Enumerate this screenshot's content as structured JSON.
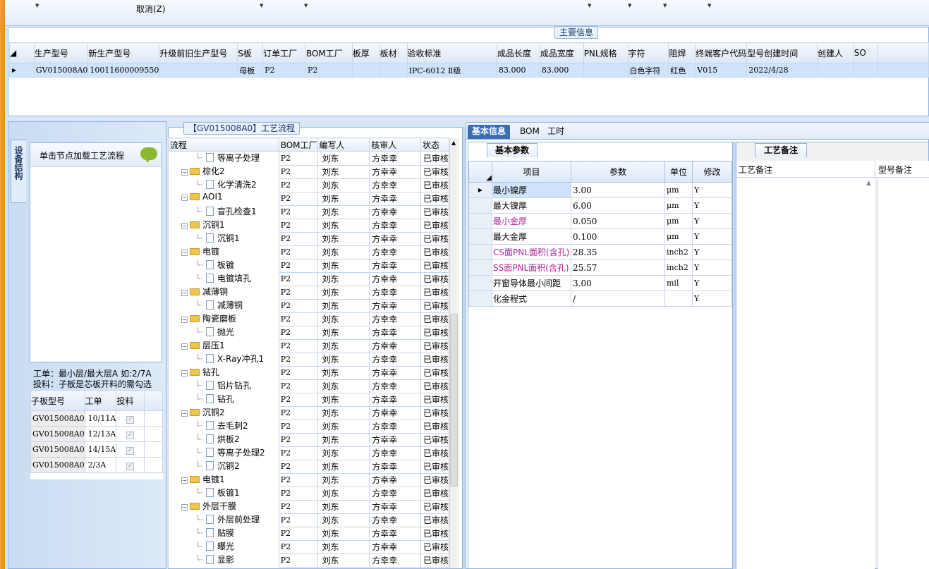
{
  "ribbon": {
    "cancel_label": "取消(Z)"
  },
  "main_info": {
    "title": "主要信息",
    "columns": [
      "生产型号",
      "新生产型号",
      "升级前旧生产型号",
      "S板",
      "订单工厂",
      "BOM工厂",
      "板厚",
      "板材",
      "验收标准",
      "成品长度",
      "成品宽度",
      "PNL规格",
      "字符",
      "阻焊",
      "终端客户代码",
      "型号创建时间",
      "创建人",
      "SO"
    ],
    "row": [
      "GV015008A0",
      "10011600009550",
      "",
      "母板",
      "P2",
      "P2",
      "",
      "",
      "IPC-6012 Ⅱ级",
      "83.000",
      "83.000",
      "",
      "白色字符",
      "红色",
      "V015",
      "2022/4/28",
      "",
      ""
    ]
  },
  "left_panel": {
    "side_tab": "设备结构",
    "load_hint": "单击节点加载工艺流程",
    "note1": "工单：最小层/最大层A 如:2/7A",
    "note2": "投料：子板是芯板开料的需勾选",
    "sub_columns": [
      "子板型号",
      "工单",
      "投料"
    ],
    "sub_rows": [
      {
        "model": "GV015008A0",
        "wo": "10/11A"
      },
      {
        "model": "GV015008A0",
        "wo": "12/13A"
      },
      {
        "model": "GV015008A0",
        "wo": "14/15A"
      },
      {
        "model": "GV015008A0",
        "wo": "2/3A"
      }
    ]
  },
  "process": {
    "title": "【GV015008A0】工艺流程",
    "columns": [
      "流程",
      "BOM工厂",
      "编写人",
      "核审人",
      "状态"
    ],
    "rows": [
      {
        "name": "等离子处理",
        "level": 2,
        "bom": "P2",
        "writer": "刘东",
        "reviewer": "方幸幸",
        "status": "已审核"
      },
      {
        "name": "棕化2",
        "level": 1,
        "bom": "P2",
        "writer": "刘东",
        "reviewer": "方幸幸",
        "status": "已审核"
      },
      {
        "name": "化学清洗2",
        "level": 2,
        "bom": "P2",
        "writer": "刘东",
        "reviewer": "方幸幸",
        "status": "已审核"
      },
      {
        "name": "AOI1",
        "level": 1,
        "bom": "P2",
        "writer": "刘东",
        "reviewer": "方幸幸",
        "status": "已审核"
      },
      {
        "name": "盲孔检查1",
        "level": 2,
        "bom": "P2",
        "writer": "刘东",
        "reviewer": "方幸幸",
        "status": "已审核"
      },
      {
        "name": "沉铜1",
        "level": 1,
        "bom": "P2",
        "writer": "刘东",
        "reviewer": "方幸幸",
        "status": "已审核"
      },
      {
        "name": "沉铜1",
        "level": 2,
        "bom": "P2",
        "writer": "刘东",
        "reviewer": "方幸幸",
        "status": "已审核"
      },
      {
        "name": "电镀",
        "level": 1,
        "bom": "P2",
        "writer": "刘东",
        "reviewer": "方幸幸",
        "status": "已审核"
      },
      {
        "name": "板镀",
        "level": 2,
        "bom": "P2",
        "writer": "刘东",
        "reviewer": "方幸幸",
        "status": "已审核"
      },
      {
        "name": "电镀填孔",
        "level": 2,
        "bom": "P2",
        "writer": "刘东",
        "reviewer": "方幸幸",
        "status": "已审核"
      },
      {
        "name": "减薄铜",
        "level": 1,
        "bom": "P2",
        "writer": "刘东",
        "reviewer": "方幸幸",
        "status": "已审核"
      },
      {
        "name": "减薄铜",
        "level": 2,
        "bom": "P2",
        "writer": "刘东",
        "reviewer": "方幸幸",
        "status": "已审核"
      },
      {
        "name": "陶瓷磨板",
        "level": 1,
        "bom": "P2",
        "writer": "刘东",
        "reviewer": "方幸幸",
        "status": "已审核"
      },
      {
        "name": "抛光",
        "level": 2,
        "bom": "P2",
        "writer": "刘东",
        "reviewer": "方幸幸",
        "status": "已审核"
      },
      {
        "name": "层压1",
        "level": 1,
        "bom": "P2",
        "writer": "刘东",
        "reviewer": "方幸幸",
        "status": "已审核"
      },
      {
        "name": "X-Ray冲孔1",
        "level": 2,
        "bom": "P2",
        "writer": "刘东",
        "reviewer": "方幸幸",
        "status": "已审核"
      },
      {
        "name": "钻孔",
        "level": 1,
        "bom": "P2",
        "writer": "刘东",
        "reviewer": "方幸幸",
        "status": "已审核"
      },
      {
        "name": "铝片钻孔",
        "level": 2,
        "bom": "P2",
        "writer": "刘东",
        "reviewer": "方幸幸",
        "status": "已审核"
      },
      {
        "name": "钻孔",
        "level": 2,
        "bom": "P2",
        "writer": "刘东",
        "reviewer": "方幸幸",
        "status": "已审核"
      },
      {
        "name": "沉铜2",
        "level": 1,
        "bom": "P2",
        "writer": "刘东",
        "reviewer": "方幸幸",
        "status": "已审核"
      },
      {
        "name": "去毛刺2",
        "level": 2,
        "bom": "P2",
        "writer": "刘东",
        "reviewer": "方幸幸",
        "status": "已审核"
      },
      {
        "name": "烘板2",
        "level": 2,
        "bom": "P2",
        "writer": "刘东",
        "reviewer": "方幸幸",
        "status": "已审核"
      },
      {
        "name": "等离子处理2",
        "level": 2,
        "bom": "P2",
        "writer": "刘东",
        "reviewer": "方幸幸",
        "status": "已审核"
      },
      {
        "name": "沉铜2",
        "level": 2,
        "bom": "P2",
        "writer": "刘东",
        "reviewer": "方幸幸",
        "status": "已审核"
      },
      {
        "name": "电镀1",
        "level": 1,
        "bom": "P2",
        "writer": "刘东",
        "reviewer": "方幸幸",
        "status": "已审核"
      },
      {
        "name": "板镀1",
        "level": 2,
        "bom": "P2",
        "writer": "刘东",
        "reviewer": "方幸幸",
        "status": "已审核"
      },
      {
        "name": "外层干膜",
        "level": 1,
        "bom": "P2",
        "writer": "刘东",
        "reviewer": "方幸幸",
        "status": "已审核"
      },
      {
        "name": "外层前处理",
        "level": 2,
        "bom": "P2",
        "writer": "刘东",
        "reviewer": "方幸幸",
        "status": "已审核"
      },
      {
        "name": "贴膜",
        "level": 2,
        "bom": "P2",
        "writer": "刘东",
        "reviewer": "方幸幸",
        "status": "已审核"
      },
      {
        "name": "曝光",
        "level": 2,
        "bom": "P2",
        "writer": "刘东",
        "reviewer": "方幸幸",
        "status": "已审核"
      },
      {
        "name": "显影",
        "level": 2,
        "bom": "P2",
        "writer": "刘东",
        "reviewer": "方幸幸",
        "status": "已审核"
      }
    ]
  },
  "info_tabs": [
    "基本信息",
    "BOM",
    "工时"
  ],
  "basic_params": {
    "tab": "基本参数",
    "columns": [
      "项目",
      "参数",
      "单位",
      "修改"
    ],
    "rows": [
      {
        "item": "最小镍厚",
        "value": "3.00",
        "unit": "μm",
        "mod": "Y",
        "pink": false
      },
      {
        "item": "最大镍厚",
        "value": "6.00",
        "unit": "μm",
        "mod": "Y",
        "pink": false
      },
      {
        "item": "最小金厚",
        "value": "0.050",
        "unit": "μm",
        "mod": "Y",
        "pink": true
      },
      {
        "item": "最大金厚",
        "value": "0.100",
        "unit": "μm",
        "mod": "Y",
        "pink": false
      },
      {
        "item": "CS面PNL面积(含孔)",
        "value": "28.35",
        "unit": "inch2",
        "mod": "Y",
        "pink": true
      },
      {
        "item": "SS面PNL面积(含孔)",
        "value": "25.57",
        "unit": "inch2",
        "mod": "Y",
        "pink": true
      },
      {
        "item": "开窗导体最小间距",
        "value": "3.00",
        "unit": "mil",
        "mod": "Y",
        "pink": false
      },
      {
        "item": "化金程式",
        "value": "/",
        "unit": "",
        "mod": "Y",
        "pink": false
      }
    ]
  },
  "remarks": {
    "tab": "工艺备注",
    "columns": [
      "工艺备注",
      "型号备注"
    ]
  },
  "colors": {
    "accent": "#3b6db5",
    "pink": "#b0229a",
    "selected": "#cfe3fb"
  }
}
